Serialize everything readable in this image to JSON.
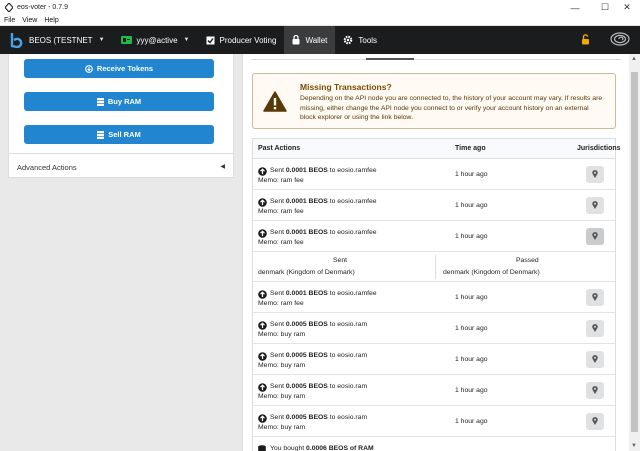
{
  "window": {
    "title": "eos-voter - 0.7.9"
  },
  "menu": [
    "File",
    "View",
    "Help"
  ],
  "nav": {
    "chain": "BEOS (TESTNET",
    "account": "yyy@active",
    "voting": "Producer Voting",
    "wallet": "Wallet",
    "tools": "Tools"
  },
  "left": {
    "receive": "Receive Tokens",
    "buy_ram": "Buy RAM",
    "sell_ram": "Sell RAM",
    "advanced": "Advanced Actions"
  },
  "warning": {
    "title": "Missing Transactions?",
    "text": "Depending on the API node you are connected to, the history of your account may vary. If results are missing, either change the API node you connect to or verify your account history on an external block explorer or using the link below."
  },
  "table": {
    "headers": {
      "actions": "Past Actions",
      "time": "Time ago",
      "juris": "Jurisdictions"
    },
    "rows": [
      {
        "pre": "Sent ",
        "amount": "0.0001 BEOS",
        "post": " to eosio.ramfee",
        "memo": "Memo: ram fee",
        "time": "1 hour ago"
      },
      {
        "pre": "Sent ",
        "amount": "0.0001 BEOS",
        "post": " to eosio.ramfee",
        "memo": "Memo: ram fee",
        "time": "1 hour ago"
      },
      {
        "pre": "Sent ",
        "amount": "0.0001 BEOS",
        "post": " to eosio.ramfee",
        "memo": "Memo: ram fee",
        "time": "1 hour ago"
      },
      {
        "pre": "Sent ",
        "amount": "0.0001 BEOS",
        "post": " to eosio.ramfee",
        "memo": "Memo: ram fee",
        "time": "1 hour ago"
      },
      {
        "pre": "Sent ",
        "amount": "0.0005 BEOS",
        "post": " to eosio.ram",
        "memo": "Memo: buy ram",
        "time": "1 hour ago"
      },
      {
        "pre": "Sent ",
        "amount": "0.0005 BEOS",
        "post": " to eosio.ram",
        "memo": "Memo: buy ram",
        "time": "1 hour ago"
      },
      {
        "pre": "Sent ",
        "amount": "0.0005 BEOS",
        "post": " to eosio.ram",
        "memo": "Memo: buy ram",
        "time": "1 hour ago"
      },
      {
        "pre": "Sent ",
        "amount": "0.0005 BEOS",
        "post": " to eosio.ram",
        "memo": "Memo: buy ram",
        "time": "1 hour ago"
      },
      {
        "pre": "You bought ",
        "amount": "0.0006 BEOS of RAM",
        "post": "",
        "memo": "",
        "time": ""
      }
    ],
    "juris": {
      "sent_label": "Sent",
      "passed_label": "Passed",
      "sent_value": "denmark (Kingdom of Denmark)",
      "passed_value": "denmark (Kingdom of Denmark)"
    }
  }
}
